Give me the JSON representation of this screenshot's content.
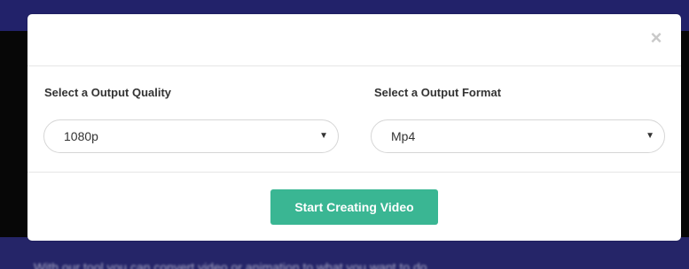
{
  "modal": {
    "close_glyph": "×",
    "quality": {
      "label": "Select a Output Quality",
      "selected": "1080p",
      "arrow_icon": "chevron-down-icon"
    },
    "format": {
      "label": "Select a Output Format",
      "selected": "Mp4",
      "arrow_icon": "chevron-down-icon"
    },
    "action_button": {
      "label": "Start Creating Video",
      "color": "#3ab693"
    }
  },
  "background": {
    "overlay_color": "#070707",
    "page_color": "#22226a",
    "partial_text": "With our tool you can convert video or animation to what you want to do"
  }
}
